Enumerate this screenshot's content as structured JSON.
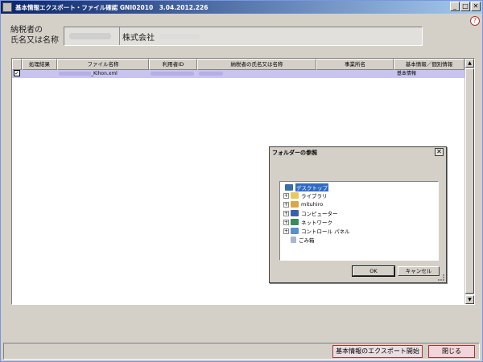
{
  "window": {
    "title": "基本情報エクスポート・ファイル確認 GNI02010　3.04.2012.226",
    "min": "_",
    "max": "□",
    "close": "✕",
    "help": "?"
  },
  "taxpayer": {
    "label_line1": "納税者の",
    "label_line2": "氏名又は名称",
    "name_suffix": "株式会社"
  },
  "table": {
    "columns": [
      "処理結果",
      "ファイル名称",
      "利用者ID",
      "納税者の氏名又は名称",
      "事業所名",
      "基本情報／個別情報"
    ],
    "rows": [
      {
        "checked": "✓",
        "file_suffix": "_Kihon.xml",
        "info_type": "基本情報"
      }
    ]
  },
  "folder_dialog": {
    "title": "フォルダーの参照",
    "close": "✕",
    "tree": [
      {
        "label": "デスクトップ",
        "icon": "desktop-icon",
        "expander": ""
      },
      {
        "label": "ライブラリ",
        "icon": "library-icon",
        "expander": "+"
      },
      {
        "label": "mituhiro",
        "icon": "user-folder-icon",
        "expander": "+"
      },
      {
        "label": "コンピューター",
        "icon": "computer-icon",
        "expander": "+"
      },
      {
        "label": "ネットワーク",
        "icon": "network-icon",
        "expander": "+"
      },
      {
        "label": "コントロール パネル",
        "icon": "control-panel-icon",
        "expander": "+"
      },
      {
        "label": "ごみ箱",
        "icon": "recycle-bin-icon",
        "expander": ""
      }
    ],
    "ok": "OK",
    "cancel": "キャンセル"
  },
  "footer": {
    "export_button": "基本情報のエクスポート開始",
    "close_button": "閉じる"
  },
  "colors": {
    "selected_row": "#c8c4f0",
    "accent_border": "#aa3333"
  }
}
